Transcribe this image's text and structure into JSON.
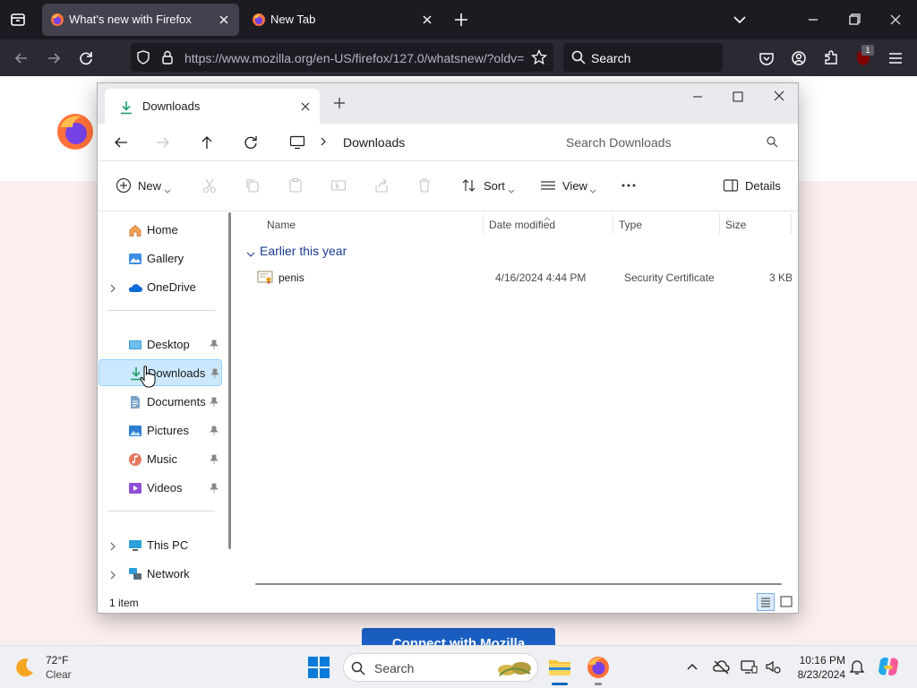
{
  "browser": {
    "tabs": [
      {
        "title": "What's new with Firefox",
        "active": true
      },
      {
        "title": "New Tab",
        "active": false
      }
    ],
    "url": "https://www.mozilla.org/en-US/firefox/127.0/whatsnew/?oldv=",
    "search_placeholder": "Search",
    "extension_badge": "1"
  },
  "page": {
    "connect_button": "Connect with Mozilla"
  },
  "explorer": {
    "tab_title": "Downloads",
    "breadcrumb": "Downloads",
    "search_placeholder": "Search Downloads",
    "toolbar": {
      "new": "New",
      "sort": "Sort",
      "view": "View",
      "details": "Details"
    },
    "nav": {
      "home": "Home",
      "gallery": "Gallery",
      "onedrive": "OneDrive",
      "desktop": "Desktop",
      "downloads": "Downloads",
      "documents": "Documents",
      "pictures": "Pictures",
      "music": "Music",
      "videos": "Videos",
      "thispc": "This PC",
      "network": "Network"
    },
    "columns": {
      "name": "Name",
      "date": "Date modified",
      "type": "Type",
      "size": "Size"
    },
    "group_label": "Earlier this year",
    "files": [
      {
        "name": "penis",
        "date": "4/16/2024 4:44 PM",
        "type": "Security Certificate",
        "size": "3 KB"
      }
    ],
    "status": "1 item"
  },
  "taskbar": {
    "weather_temp": "72°F",
    "weather_desc": "Clear",
    "search_label": "Search",
    "time": "10:16 PM",
    "date": "8/23/2024"
  },
  "colors": {
    "firefox_tabbar": "#1c1b22",
    "firefox_navbar": "#2b2a33",
    "page_bg": "#fbeeee",
    "selection": "#cce8ff",
    "accent": "#0067c0"
  }
}
